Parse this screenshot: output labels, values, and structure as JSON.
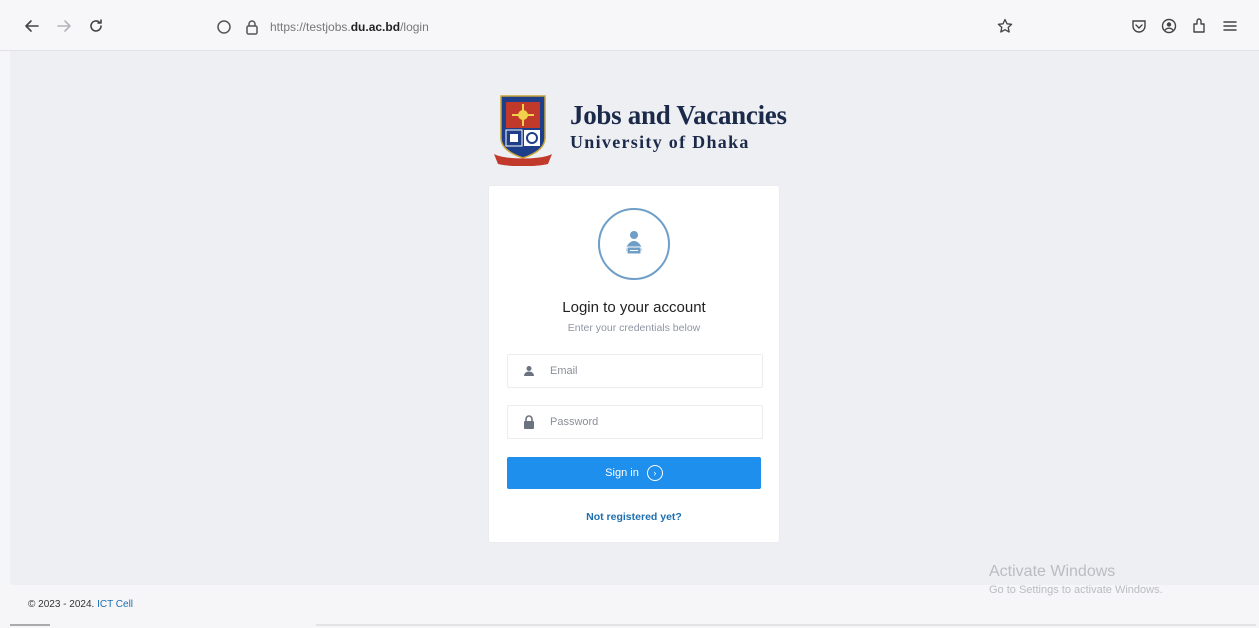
{
  "browser": {
    "url_prefix": "https://testjobs.",
    "url_domain": "du.ac.bd",
    "url_path": "/login",
    "icons": [
      "back-arrow-icon",
      "forward-arrow-icon",
      "reload-icon",
      "tracking-shield-icon",
      "lock-icon",
      "bookmark-star-icon",
      "pocket-icon",
      "account-icon",
      "extensions-icon",
      "menu-icon"
    ]
  },
  "brand": {
    "title": "Jobs and Vacancies",
    "subtitle": "University of Dhaka"
  },
  "login": {
    "title": "Login to your account",
    "subtitle": "Enter your credentials below",
    "email_placeholder": "Email",
    "password_placeholder": "Password",
    "signin_label": "Sign in",
    "register_link": "Not registered yet?"
  },
  "watermark": {
    "line1": "Activate Windows",
    "line2": "Go to Settings to activate Windows."
  },
  "footer": {
    "copyright": "© 2023 - 2024.",
    "link": "ICT Cell"
  },
  "colors": {
    "accent": "#1e8fec",
    "link": "#1d6fb1",
    "brand_text": "#1c2a4a"
  }
}
